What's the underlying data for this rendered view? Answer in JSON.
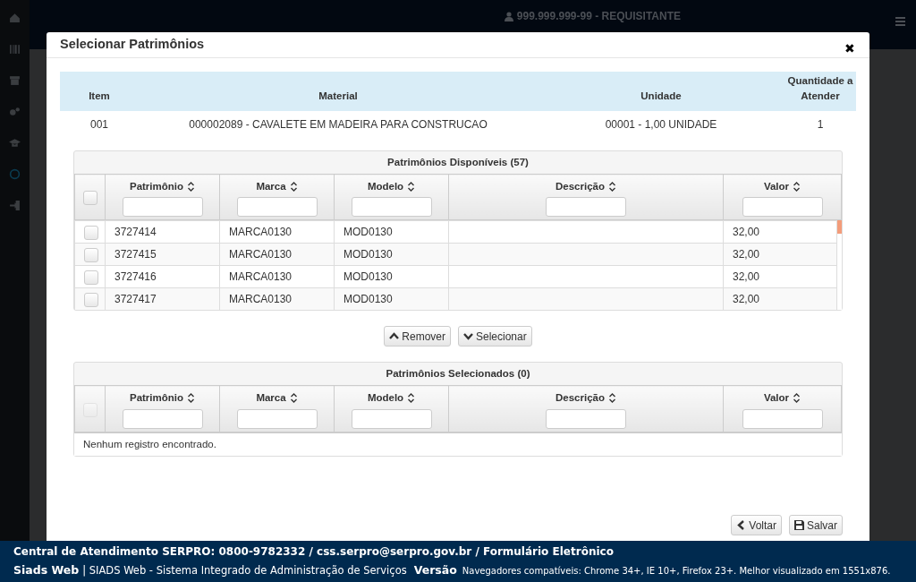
{
  "topbar": {
    "user": "999.999.999-99 - REQUISITANTE"
  },
  "modal": {
    "title": "Selecionar Patrimônios",
    "close": "✖",
    "item_table": {
      "columns": [
        "Item",
        "Material",
        "Unidade",
        "Quantidade a Atender"
      ],
      "rows": [
        [
          "001",
          "000002089 - CAVALETE EM MADEIRA PARA CONSTRUCAO",
          "00001 - 1,00 UNIDADE",
          "1"
        ]
      ]
    },
    "available": {
      "title": "Patrimônios Disponíveis (57)",
      "select_all": {
        "checked": false,
        "disabled": false
      },
      "columns": [
        "Patrimônio",
        "Marca",
        "Modelo",
        "Descrição",
        "Valor"
      ],
      "rows": [
        {
          "checked": false,
          "cells": [
            "3727414",
            "MARCA0130",
            "MOD0130",
            "",
            "32,00"
          ]
        },
        {
          "checked": false,
          "cells": [
            "3727415",
            "MARCA0130",
            "MOD0130",
            "",
            "32,00"
          ]
        },
        {
          "checked": false,
          "cells": [
            "3727416",
            "MARCA0130",
            "MOD0130",
            "",
            "32,00"
          ]
        },
        {
          "checked": false,
          "cells": [
            "3727417",
            "MARCA0130",
            "MOD0130",
            "",
            "32,00"
          ]
        }
      ]
    },
    "move_buttons": [
      {
        "label": "Remover",
        "kind": "up"
      },
      {
        "label": "Selecionar",
        "kind": "down"
      }
    ],
    "selected": {
      "title": "Patrimônios Selecionados (0)",
      "select_all": {
        "checked": false,
        "disabled": true
      },
      "columns": [
        "Patrimônio",
        "Marca",
        "Modelo",
        "Descrição",
        "Valor"
      ],
      "empty": "Nenhum registro encontrado."
    },
    "footer_buttons": [
      {
        "label": "Voltar",
        "kind": "back"
      },
      {
        "label": "Salvar",
        "kind": "save"
      }
    ]
  },
  "footer": {
    "contact": "Central de Atendimento SERPRO: 0800-9782332 / css.serpro@serpro.gov.br / Formulário Eletrônico",
    "brand": "Siads Web",
    "system": "| SIADS Web - Sistema Integrado de Administração de Serviços",
    "version": "Versão",
    "browsers": "Navegadores compatíveis: Chrome 34+, IE 10+, Firefox 23+. Melhor visualizado em 1551x876."
  }
}
